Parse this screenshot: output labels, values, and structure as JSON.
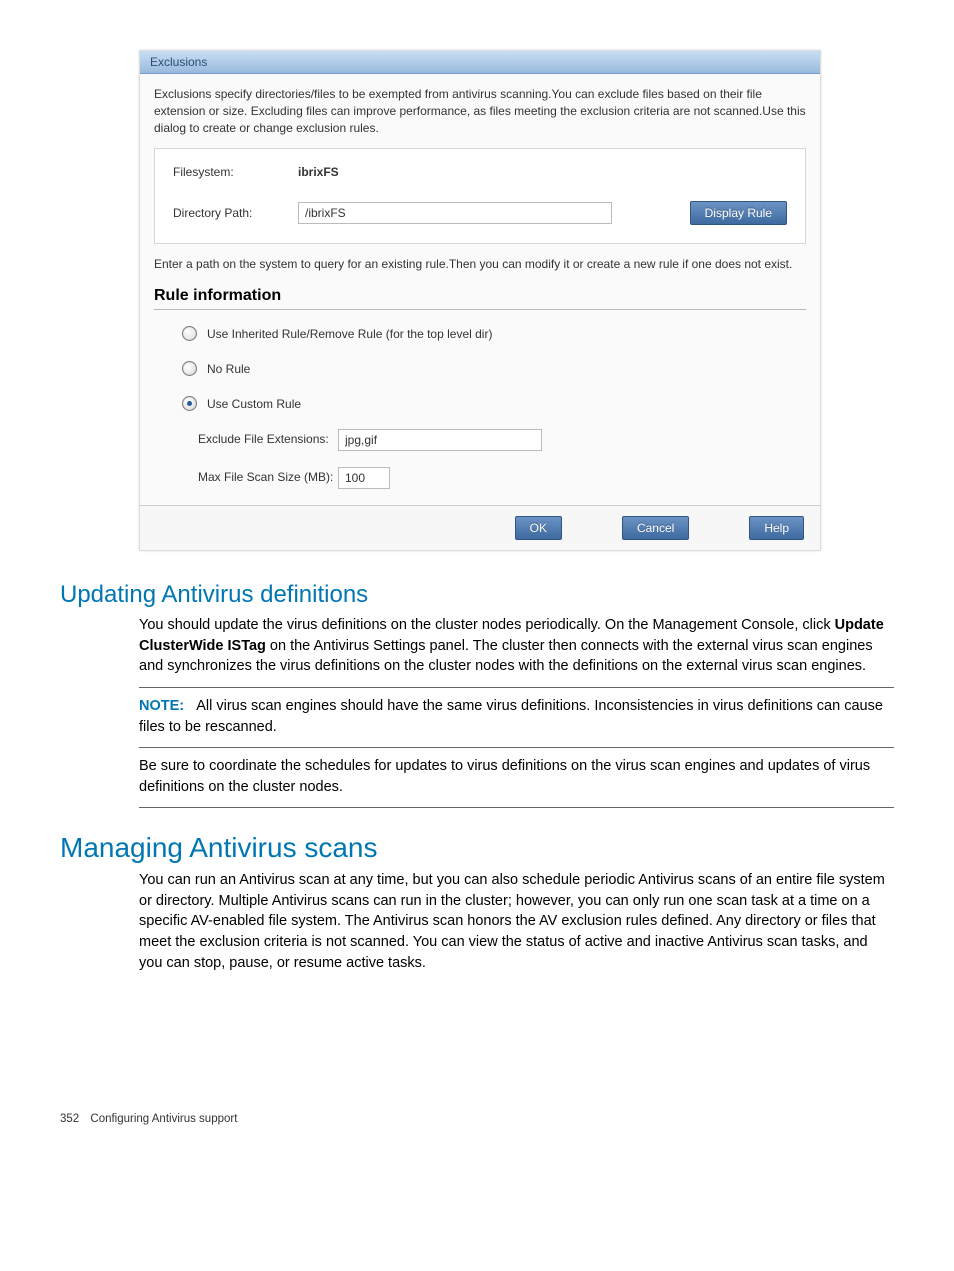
{
  "dialog": {
    "title": "Exclusions",
    "intro": "Exclusions specify directories/files to be exempted from antivirus scanning.You can exclude files based on their file extension or size. Excluding files can improve performance, as files meeting the exclusion criteria are not scanned.Use this dialog to create or change exclusion rules.",
    "filesystem_label": "Filesystem:",
    "filesystem_value": "ibrixFS",
    "dirpath_label": "Directory Path:",
    "dirpath_value": "/ibrixFS",
    "display_rule_btn": "Display Rule",
    "hint": "Enter a path on the system to query for an existing rule.Then you can modify it or create a new rule if one does not exist.",
    "rule_heading": "Rule information",
    "radios": {
      "inherited": "Use Inherited Rule/Remove Rule (for the top level dir)",
      "norule": "No Rule",
      "custom": "Use Custom Rule"
    },
    "custom": {
      "ext_label": "Exclude File Extensions:",
      "ext_value": "jpg,gif",
      "size_label": "Max File Scan Size (MB):",
      "size_value": "100"
    },
    "buttons": {
      "ok": "OK",
      "cancel": "Cancel",
      "help": "Help"
    }
  },
  "doc": {
    "h2_update": "Updating Antivirus definitions",
    "update_p1a": "You should update the virus definitions on the cluster nodes periodically. On the Management Console, click ",
    "update_p1_bold": "Update ClusterWide ISTag",
    "update_p1b": " on the Antivirus Settings panel. The cluster then connects with the external virus scan engines and synchronizes the virus definitions on the cluster nodes with the definitions on the external virus scan engines.",
    "note_label": "NOTE:",
    "note_text": "All virus scan engines should have the same virus definitions. Inconsistencies in virus definitions can cause files to be rescanned.",
    "update_p2": "Be sure to coordinate the schedules for updates to virus definitions on the virus scan engines and updates of virus definitions on the cluster nodes.",
    "h1_manage": "Managing Antivirus scans",
    "manage_p1": "You can run an Antivirus scan at any time, but you can also schedule periodic Antivirus scans of an entire file system or directory. Multiple Antivirus scans can run in the cluster; however, you can only run one scan task at a time on a specific AV-enabled file system. The Antivirus scan honors the AV exclusion rules defined. Any directory or files that meet the exclusion criteria is not scanned. You can view the status of active and inactive Antivirus scan tasks, and you can stop, pause, or resume active tasks."
  },
  "footer": {
    "page_number": "352",
    "chapter": "Configuring Antivirus support"
  }
}
